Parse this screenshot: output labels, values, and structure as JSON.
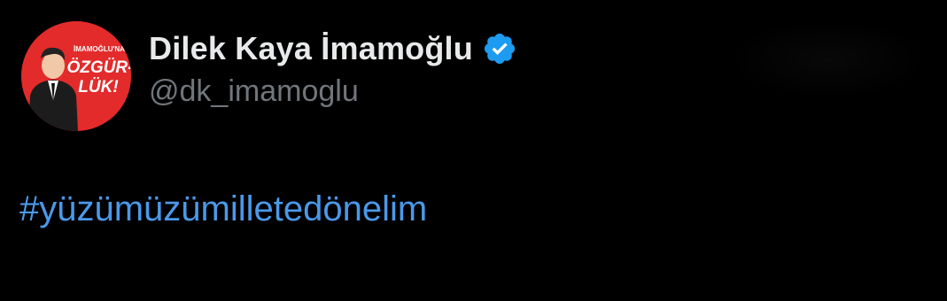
{
  "post": {
    "author": {
      "display_name": "Dilek Kaya İmamoğlu",
      "handle": "@dk_imamoglu",
      "verified": true,
      "avatar": {
        "icon": "profile-avatar-campaign-badge",
        "text_line1": "İMAMOĞLU'NA",
        "text_line2": "ÖZGÜR-",
        "text_line3": "LÜK!"
      }
    },
    "body": {
      "hashtag": "#yüzümüzümilletedönelim"
    }
  },
  "colors": {
    "background": "#000000",
    "name_text": "#e7e9ea",
    "handle_text": "#71767b",
    "hashtag_link": "#4a99e9",
    "verified_badge": "#1d9bf0",
    "avatar_background": "#e32b2b"
  }
}
